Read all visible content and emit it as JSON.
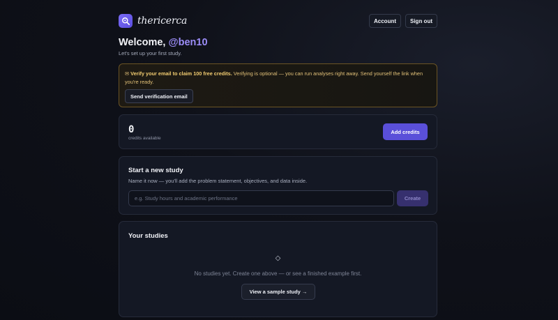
{
  "header": {
    "brand": "thericerca",
    "logo_icon": "search-icon",
    "account_label": "Account",
    "signout_label": "Sign out"
  },
  "welcome": {
    "greeting": "Welcome,",
    "handle": "@ben10",
    "subtitle": "Let's set up your first study."
  },
  "verify_banner": {
    "icon": "mail-icon",
    "bold_text": "Verify your email to claim 100 free credits.",
    "text": " Verifying is optional — you can run analyses right away. Send yourself the link when you're ready.",
    "button_label": "Send verification email"
  },
  "credits": {
    "value": "0",
    "label": "credits available",
    "button_label": "Add credits"
  },
  "new_study": {
    "title": "Start a new study",
    "description": "Name it now — you'll add the problem statement, objectives, and data inside.",
    "input_value": "",
    "input_placeholder": "e.g. Study hours and academic performance",
    "create_label": "Create"
  },
  "your_studies": {
    "title": "Your studies",
    "empty_icon": "◇",
    "empty_text": "No studies yet. Create one above — or see a finished example first.",
    "sample_button_label": "View a sample study →"
  },
  "colors": {
    "accent": "#5a4fd9",
    "handle": "#9c8df8",
    "warning": "#f2cc70"
  }
}
